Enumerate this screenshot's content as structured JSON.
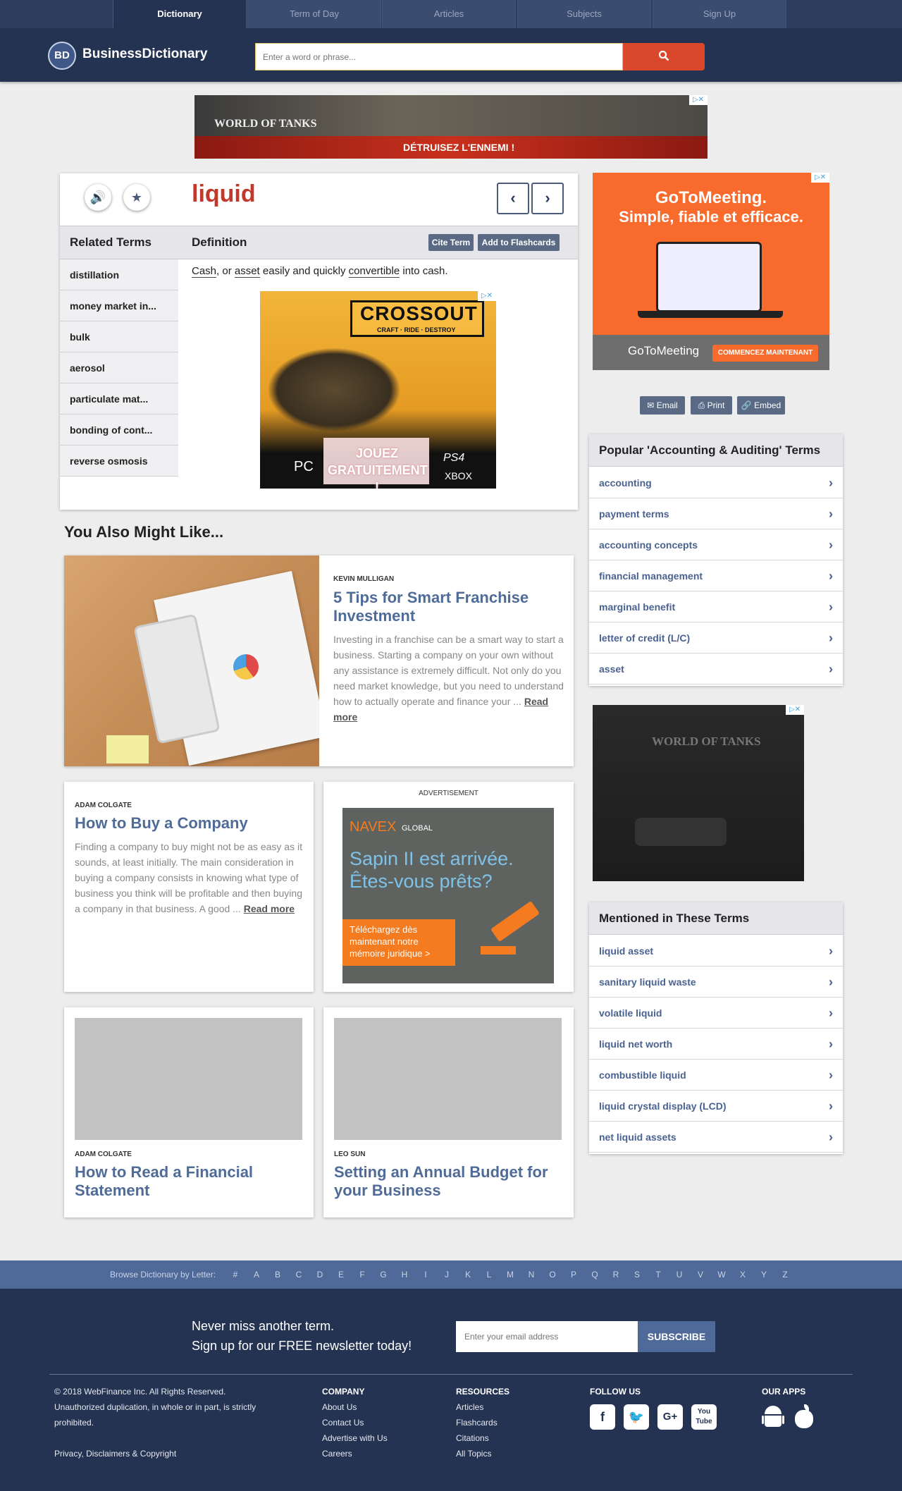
{
  "nav": {
    "tabs": [
      "Dictionary",
      "Term of Day",
      "Articles",
      "Subjects",
      "Sign Up"
    ]
  },
  "header": {
    "logo_badge": "BD",
    "logo_text": "BusinessDictionary",
    "search_placeholder": "Enter a word or phrase..."
  },
  "ads": {
    "top_banner": {
      "brand": "WORLD OF TANKS",
      "cta": "DÉTRUISEZ L'ENNEMI !"
    },
    "right_top": {
      "headline1": "GoToMeeting.",
      "headline2": "Simple, fiable et efficace.",
      "brand": "GoToMeeting",
      "cta": "COMMENCEZ MAINTENANT"
    },
    "in_def": {
      "brand": "CROSSOUT",
      "tagline": "CRAFT · RIDE · DESTROY",
      "cta": "JOUEZ GRATUITEMENT !",
      "platform1": "PC",
      "platform2": "PS4",
      "platform3": "XBOX"
    },
    "right_mid": {
      "brand": "WORLD OF TANKS"
    },
    "navex": {
      "label": "ADVERTISEMENT",
      "brand": "NAVEX",
      "brand_sub": "GLOBAL",
      "headline": "Sapin II est arrivée. Êtes-vous prêts?",
      "cta": "Téléchargez dès maintenant notre mémoire juridique >"
    }
  },
  "term": {
    "word": "liquid",
    "related_heading": "Related Terms",
    "definition_heading": "Definition",
    "cite_label": "Cite Term",
    "flashcards_label": "Add to Flashcards",
    "related": [
      "distillation",
      "money market in...",
      "bulk",
      "aerosol",
      "particulate mat...",
      "bonding of cont...",
      "reverse osmosis"
    ],
    "definition": {
      "w1": "Cash",
      "t1": ", or ",
      "w2": "asset",
      "t2": " easily and quickly ",
      "w3": "convertible",
      "t3": " into cash."
    }
  },
  "share": {
    "email": "Email",
    "print": "Print",
    "embed": "Embed"
  },
  "popular": {
    "heading": "Popular 'Accounting & Auditing' Terms",
    "items": [
      "accounting",
      "payment terms",
      "accounting concepts",
      "financial management",
      "marginal benefit",
      "letter of credit (L/C)",
      "asset"
    ]
  },
  "mentioned": {
    "heading": "Mentioned in These Terms",
    "items": [
      "liquid asset",
      "sanitary liquid waste",
      "volatile liquid",
      "liquid net worth",
      "combustible liquid",
      "liquid crystal display (LCD)",
      "net liquid assets"
    ]
  },
  "articles": {
    "heading": "You Also Might Like...",
    "read_more": "Read more",
    "a1": {
      "author": "KEVIN MULLIGAN",
      "title": "5 Tips for Smart Franchise Investment",
      "excerpt": "Investing in a franchise can be a smart way to start a business. Starting a company on your own without any assistance is extremely difficult. Not only do you need market knowledge, but you need to understand how to actually operate and finance your ..."
    },
    "a2": {
      "author": "ADAM COLGATE",
      "title": "How to Buy a Company",
      "excerpt": "Finding a company to buy might not be as easy as it sounds, at least initially. The main consideration in buying a company consists in knowing what type of business you think will be profitable and then buying a company in that business. A good ..."
    },
    "a3": {
      "author": "ADAM COLGATE",
      "title": "How to Read a Financial Statement"
    },
    "a4": {
      "author": "LEO SUN",
      "title": "Setting an Annual Budget for your Business"
    }
  },
  "browse": {
    "label": "Browse Dictionary by Letter:",
    "letters": [
      "#",
      "A",
      "B",
      "C",
      "D",
      "E",
      "F",
      "G",
      "H",
      "I",
      "J",
      "K",
      "L",
      "M",
      "N",
      "O",
      "P",
      "Q",
      "R",
      "S",
      "T",
      "U",
      "V",
      "W",
      "X",
      "Y",
      "Z"
    ]
  },
  "footer": {
    "newsletter1": "Never miss another term.",
    "newsletter2": "Sign up for our FREE newsletter today!",
    "email_placeholder": "Enter your email address",
    "subscribe": "SUBSCRIBE",
    "copyright1": "© 2018 WebFinance Inc. All Rights Reserved.",
    "copyright2": "Unauthorized duplication, in whole or in part, is strictly",
    "copyright3": "prohibited.",
    "privacy": "Privacy, Disclaimers & Copyright",
    "company_head": "COMPANY",
    "company": [
      "About Us",
      "Contact Us",
      "Advertise with Us",
      "Careers"
    ],
    "resources_head": "RESOURCES",
    "resources": [
      "Articles",
      "Flashcards",
      "Citations",
      "All Topics"
    ],
    "follow_head": "FOLLOW US",
    "apps_head": "OUR APPS"
  },
  "colors": {
    "navy": "#253352",
    "accent_red": "#c0392b",
    "link_blue": "#4f6c99"
  }
}
